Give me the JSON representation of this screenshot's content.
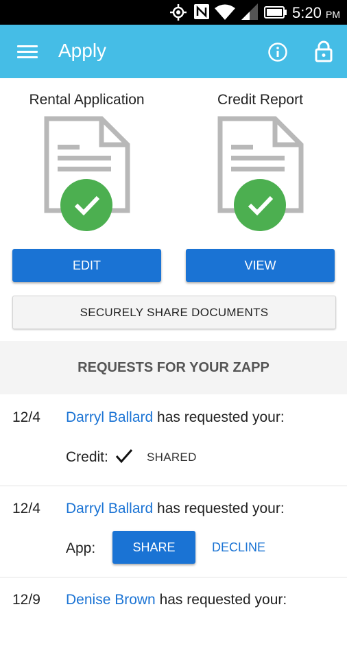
{
  "status_bar": {
    "time": "5:20",
    "ampm": "PM"
  },
  "app_bar": {
    "title": "Apply",
    "icons": [
      "menu-icon",
      "info-icon",
      "lock-icon"
    ]
  },
  "documents": [
    {
      "title": "Rental Application",
      "button": "EDIT",
      "status_icon": "check-icon"
    },
    {
      "title": "Credit Report",
      "button": "VIEW",
      "status_icon": "check-icon"
    }
  ],
  "share_button": "SECURELY SHARE DOCUMENTS",
  "requests_header": "REQUESTS FOR YOUR ZAPP",
  "requests": [
    {
      "date": "12/4",
      "name": "Darryl Ballard",
      "text": "has requested your:",
      "type": "Credit:",
      "status": "SHARED"
    },
    {
      "date": "12/4",
      "name": "Darryl Ballard",
      "text": "has requested your:",
      "type": "App:",
      "share": "SHARE",
      "decline": "DECLINE"
    },
    {
      "date": "12/9",
      "name": "Denise Brown",
      "text": "has requested your:"
    }
  ],
  "colors": {
    "app_bar": "#45bde6",
    "primary": "#1a73d4",
    "success": "#4caf50"
  }
}
